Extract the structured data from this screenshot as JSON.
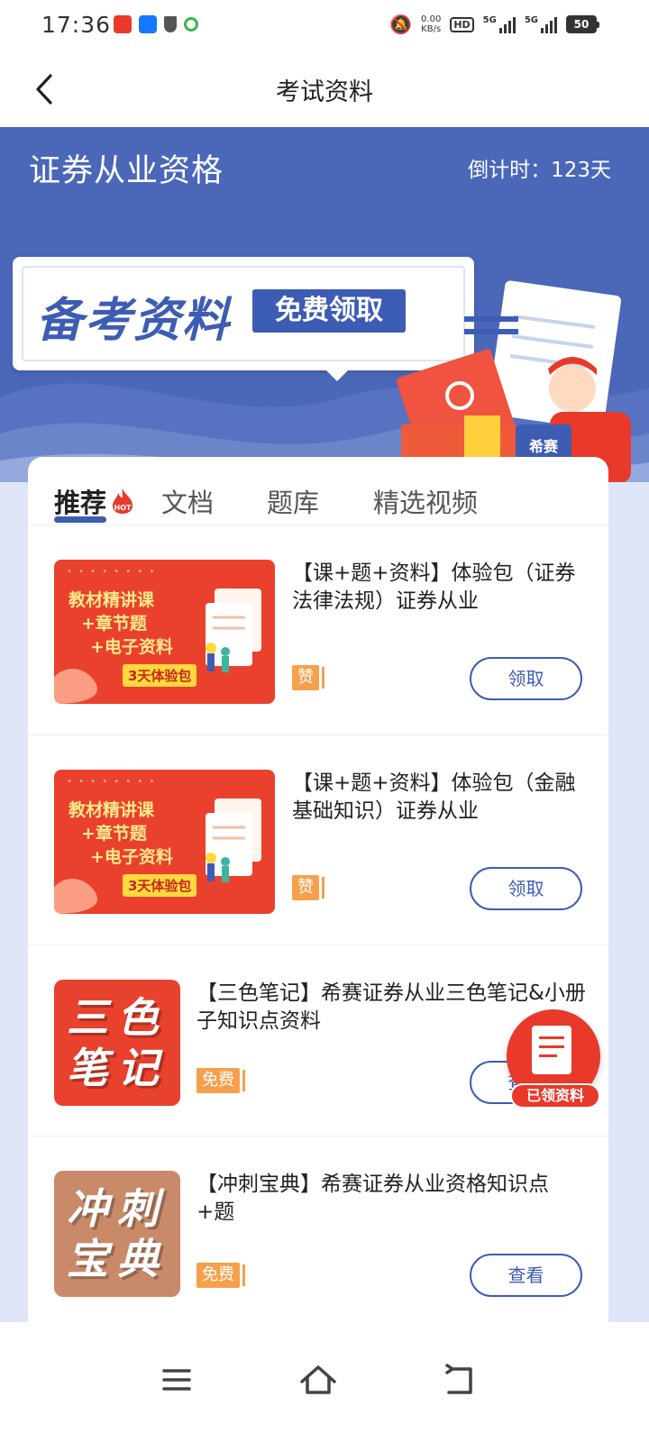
{
  "status_bar": {
    "time": "17:36",
    "net_speed_value": "0.00",
    "net_speed_unit": "KB/s",
    "hd_label": "HD",
    "sim1": "5G",
    "sim2": "5G",
    "battery": "50"
  },
  "nav": {
    "title": "考试资料"
  },
  "banner": {
    "cert_title": "证券从业资格",
    "countdown": "倒计时：123天",
    "promo_main": "备考资料",
    "promo_free": "免费领取",
    "illus_label": "希赛"
  },
  "tabs": [
    {
      "label": "推荐",
      "active": true
    },
    {
      "label": "文档",
      "active": false
    },
    {
      "label": "题库",
      "active": false
    },
    {
      "label": "精选视频",
      "active": false
    }
  ],
  "items": [
    {
      "title": "【课+题+资料】体验包（证券法律法规）证券从业",
      "tag": "赞",
      "button": "领取",
      "thumb": {
        "line1": "教材精讲课",
        "line2": "+章节题",
        "line3": "+电子资料",
        "badge": "3天体验包"
      }
    },
    {
      "title": "【课+题+资料】体验包（金融基础知识）证券从业",
      "tag": "赞",
      "button": "领取",
      "thumb": {
        "line1": "教材精讲课",
        "line2": "+章节题",
        "line3": "+电子资料",
        "badge": "3天体验包"
      }
    },
    {
      "title": "【三色笔记】希赛证券从业三色笔记&小册子知识点资料",
      "tag": "免费",
      "button": "查看",
      "thumb": {
        "text": "三色笔记",
        "bg": "#e8412e"
      }
    },
    {
      "title": "【冲刺宝典】希赛证券从业资格知识点+题",
      "tag": "免费",
      "button": "查看",
      "thumb": {
        "text": "冲刺宝典",
        "bg": "#c98a6a"
      }
    }
  ],
  "floating": {
    "label": "已领资料"
  },
  "colors": {
    "primary": "#3d5cb3",
    "banner": "#4a67b8",
    "accent_red": "#e8392a",
    "tag_orange": "#f7a04c"
  }
}
